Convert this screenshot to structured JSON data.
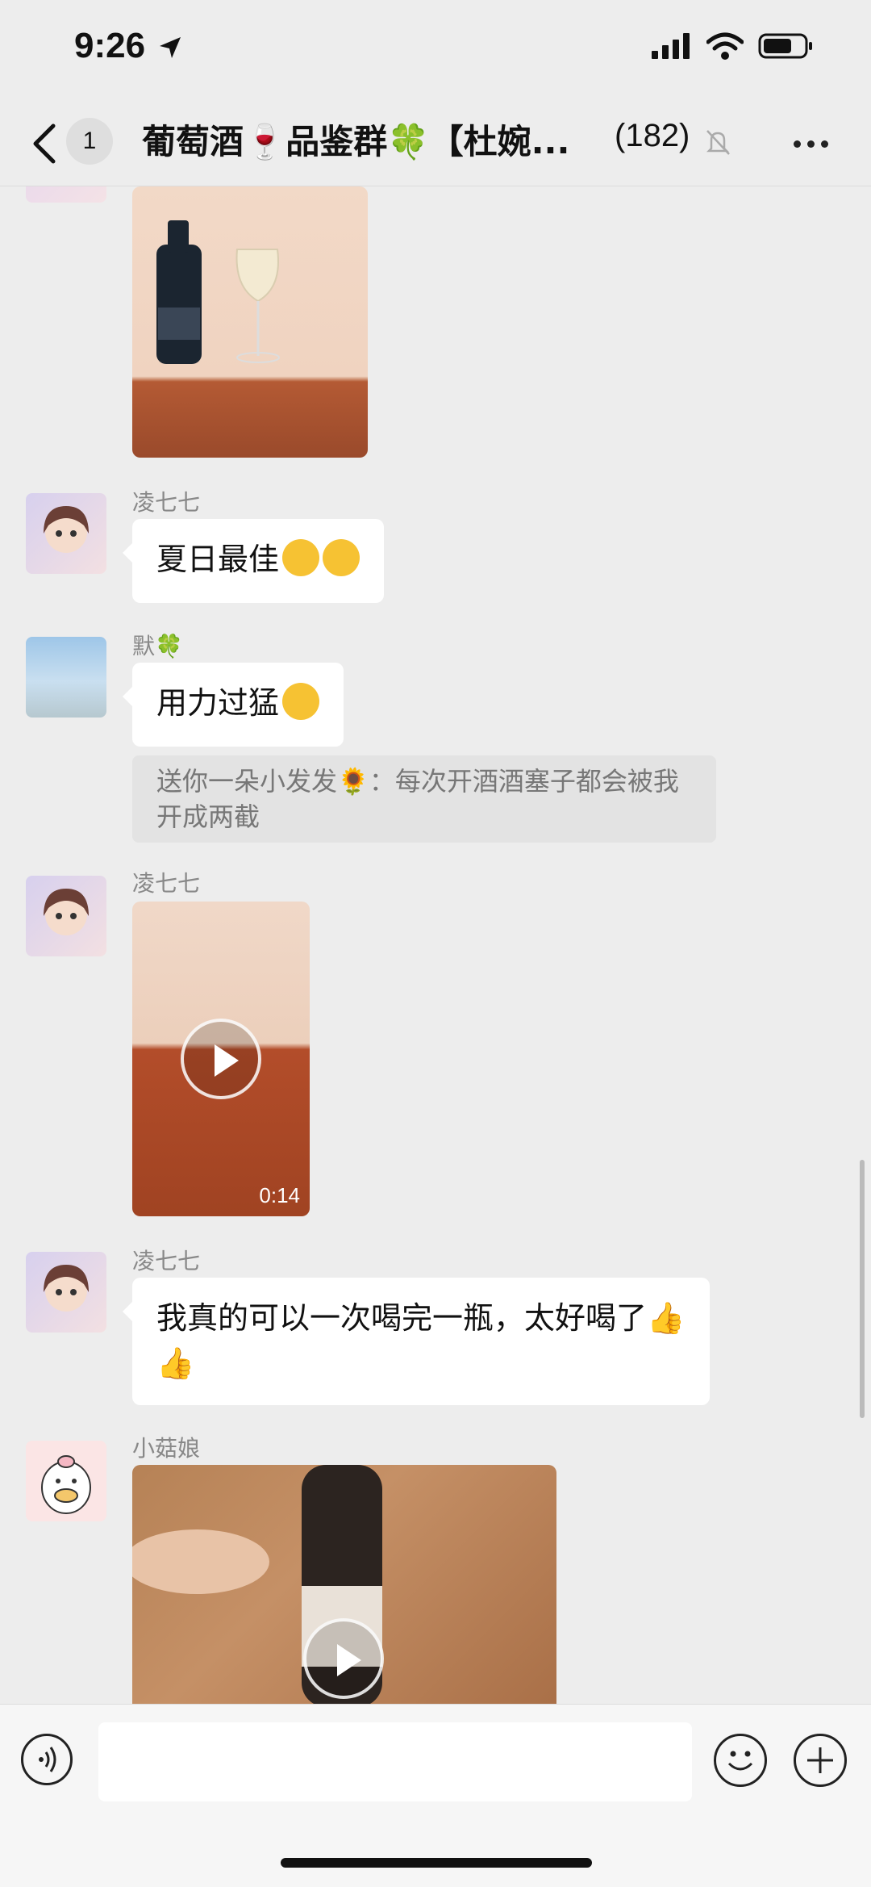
{
  "status_bar": {
    "time": "9:26"
  },
  "nav": {
    "unread_count": "1",
    "title": "葡萄酒🍷品鉴群🍀【杜婉...",
    "member_count": "(182)"
  },
  "messages": [
    {
      "sender": "凌七七",
      "text": "夏日最佳",
      "emoji": [
        "grin-emoji",
        "grin-emoji"
      ]
    },
    {
      "sender": "默🍀",
      "text": "用力过猛",
      "emoji": [
        "thinking-emoji"
      ]
    },
    {
      "quote": "送你一朵小发发🌻：每次开酒酒塞子都会被我开成两截"
    },
    {
      "sender": "凌七七",
      "video_duration": "0:14"
    },
    {
      "sender": "凌七七",
      "text": "我真的可以一次喝完一瓶，太好喝了👍👍"
    },
    {
      "sender": "小菇娘"
    }
  ],
  "input": {
    "value": "",
    "placeholder": ""
  },
  "colors": {
    "background": "#ededed",
    "bubble": "#ffffff",
    "quote": "#e3e3e3"
  }
}
